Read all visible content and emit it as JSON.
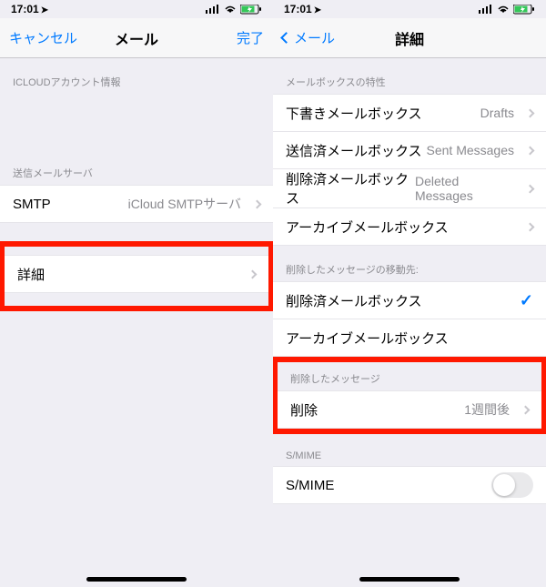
{
  "status": {
    "time": "17:01",
    "location_icon": "location-arrow"
  },
  "left": {
    "nav": {
      "cancel": "キャンセル",
      "title": "メール",
      "done": "完了"
    },
    "section_icloud_header": "ICLOUDアカウント情報",
    "section_outgoing_header": "送信メールサーバ",
    "smtp_label": "SMTP",
    "smtp_value": "iCloud SMTPサーバ",
    "advanced_label": "詳細"
  },
  "right": {
    "nav": {
      "back": "メール",
      "title": "詳細"
    },
    "section_mailbox_header": "メールボックスの特性",
    "mailbox": {
      "drafts_label": "下書きメールボックス",
      "drafts_value": "Drafts",
      "sent_label": "送信済メールボックス",
      "sent_value": "Sent Messages",
      "deleted_label": "削除済メールボックス",
      "deleted_value": "Deleted Messages",
      "archive_label": "アーカイブメールボックス"
    },
    "moveto_header": "削除したメッセージの移動先:",
    "moveto": {
      "deleted": "削除済メールボックス",
      "archive": "アーカイブメールボックス",
      "selected": "deleted"
    },
    "deleted_header": "削除したメッセージ",
    "delete_label": "削除",
    "delete_value": "1週間後",
    "smime_header": "S/MIME",
    "smime_label": "S/MIME",
    "smime_on": false
  },
  "colors": {
    "accent": "#007aff",
    "highlight": "#ff1800"
  }
}
